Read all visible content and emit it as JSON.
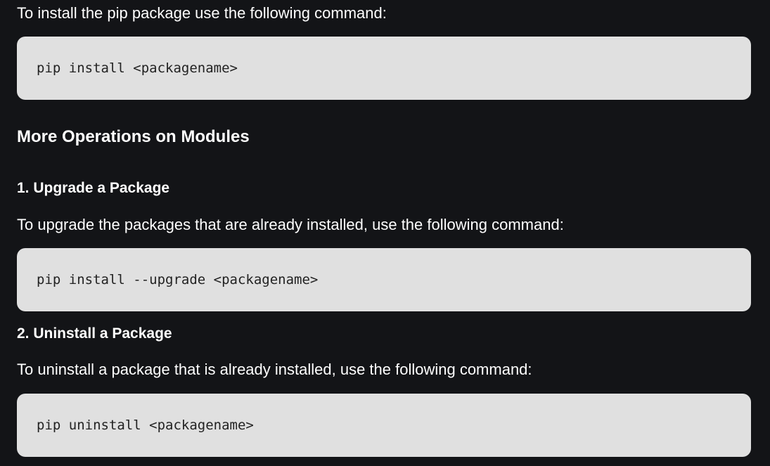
{
  "intro": {
    "text": "To install the pip package use the following command:",
    "command": "pip install <packagename>"
  },
  "section": {
    "title": "More Operations on Modules"
  },
  "upgrade": {
    "heading": "1. Upgrade a Package",
    "text": "To upgrade the packages that are already installed, use the following command:",
    "command": "pip install --upgrade <packagename>"
  },
  "uninstall": {
    "heading": "2. Uninstall a Package",
    "text": "To uninstall a package that is already installed, use the following command:",
    "command": "pip uninstall <packagename>"
  },
  "colors": {
    "background": "#131417",
    "code_background": "#e0e0e0",
    "text": "#ffffff",
    "code_text": "#222222"
  }
}
